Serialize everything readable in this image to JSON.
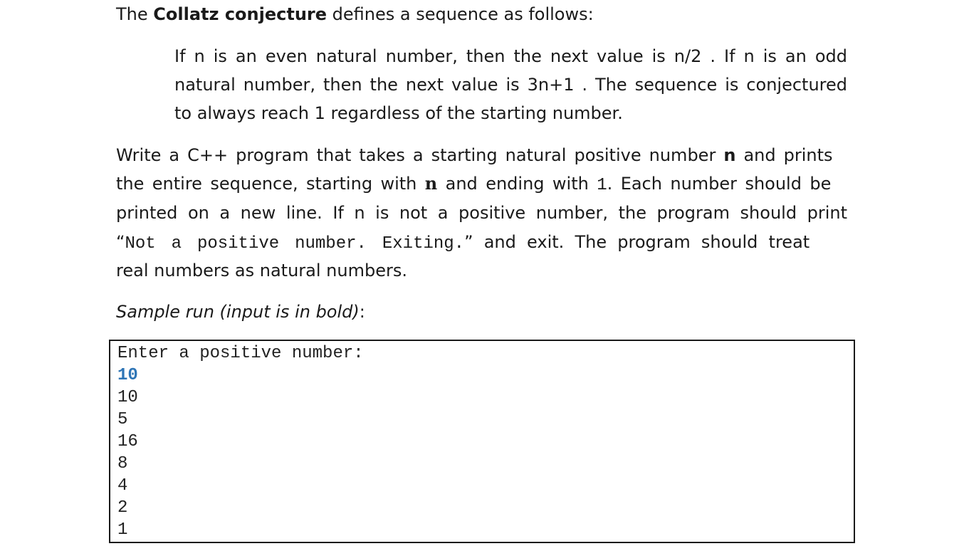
{
  "intro": {
    "prefix": "The ",
    "term": "Collatz conjecture",
    "suffix": " defines a sequence as follows:"
  },
  "definition_lines": [
    "If n is an even natural number, then the next value is n/2 . If n is an odd",
    "natural number, then the next value is 3n+1 . The sequence is conjectured",
    "to always reach 1 regardless of the starting number."
  ],
  "task": {
    "line1_a": "Write a C++ program that takes a starting natural positive number ",
    "line1_n": "n",
    "line1_b": " and prints",
    "line2_a": "the entire sequence, starting with ",
    "line2_n": "n",
    "line2_b": " and ending with ",
    "line2_one": "1",
    "line2_c": ". Each number should be",
    "line3": "printed on a new line. If n is not a positive number, the program should print",
    "line4_q1": "“",
    "line4_mono": "Not a positive number. Exiting.",
    "line4_q2": "” and exit.  The program should treat",
    "line5": "real numbers as natural numbers."
  },
  "sample_heading": {
    "text": "Sample run (input is in bold)",
    "colon": ":"
  },
  "console": {
    "prompt": "Enter a positive number:",
    "input": "10",
    "outputs": [
      "10",
      "5",
      "16",
      "8",
      "4",
      "2",
      "1"
    ]
  }
}
